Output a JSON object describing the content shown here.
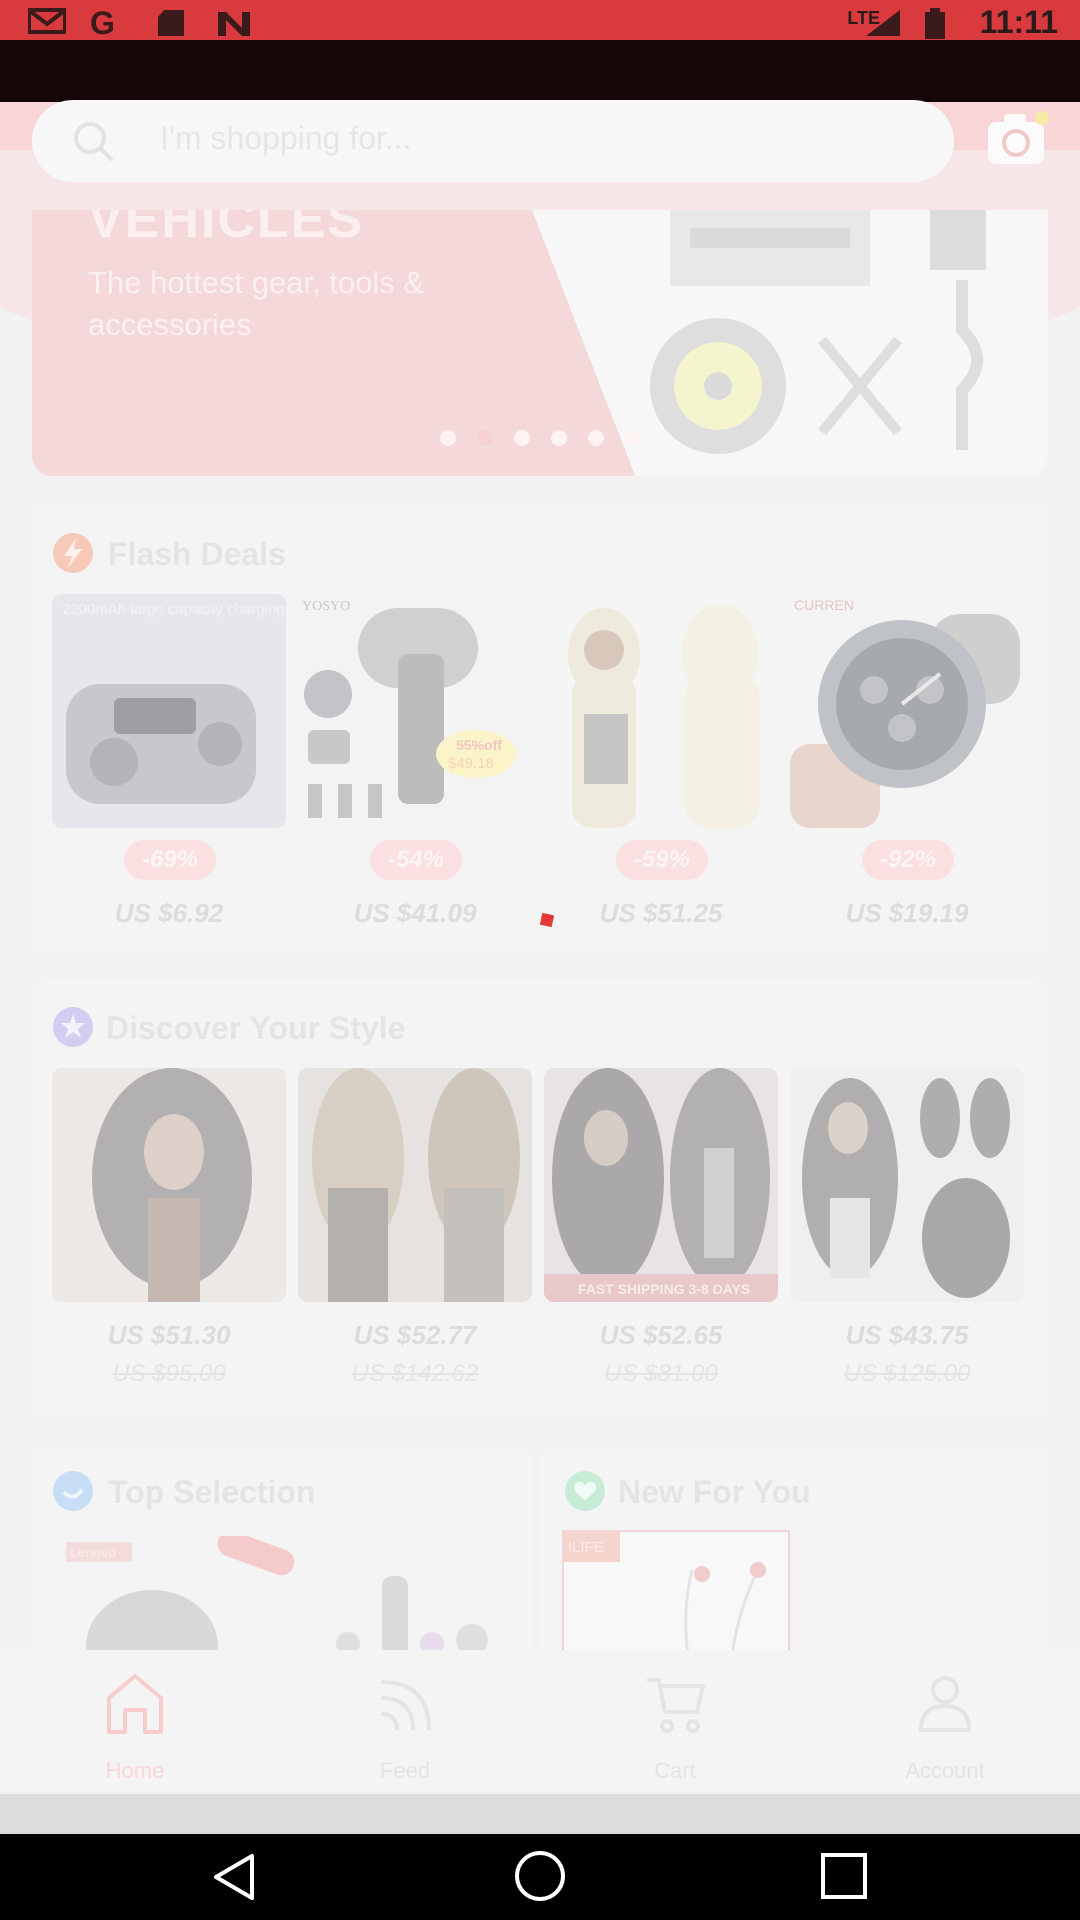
{
  "status_bar": {
    "time": "11:11",
    "network": "LTE",
    "icons": [
      "gmail-icon",
      "google-icon",
      "sd-card-icon",
      "n-app-icon",
      "signal-icon",
      "battery-icon"
    ]
  },
  "search": {
    "placeholder": "I'm shopping for..."
  },
  "banner": {
    "title": "VEHICLES",
    "subtitle": "The hottest gear, tools & accessories",
    "active_dot_index": 1,
    "dot_count": 6
  },
  "flash_deals": {
    "title": "Flash Deals",
    "items": [
      {
        "discount": "-69%",
        "price": "US $6.92",
        "image_caption": "2200mAh large capacity charging box"
      },
      {
        "discount": "-54%",
        "price": "US $41.09",
        "image_caption": "YOSYO",
        "sticker_top": "55%off",
        "sticker_price": "$49.18"
      },
      {
        "discount": "-59%",
        "price": "US $51.25",
        "image_caption": ""
      },
      {
        "discount": "-92%",
        "price": "US $19.19",
        "image_caption": "CURREN"
      }
    ]
  },
  "discover": {
    "title": "Discover Your Style",
    "items": [
      {
        "price": "US $51.30",
        "old_price": "US $95.00"
      },
      {
        "price": "US $52.77",
        "old_price": "US $142.62"
      },
      {
        "price": "US $52.65",
        "old_price": "US $81.00",
        "ribbon": "FAST SHIPPING 3-8 DAYS"
      },
      {
        "price": "US $43.75",
        "old_price": "US $125.00"
      }
    ]
  },
  "top_selection": {
    "title": "Top Selection",
    "brand": "Lenovo"
  },
  "new_for_you": {
    "title": "New For You",
    "brand": "ILIFE"
  },
  "bottom_nav": {
    "items": [
      {
        "label": "Home",
        "icon": "home-icon",
        "active": true
      },
      {
        "label": "Feed",
        "icon": "feed-icon",
        "active": false
      },
      {
        "label": "Cart",
        "icon": "cart-icon",
        "active": false
      },
      {
        "label": "Account",
        "icon": "account-icon",
        "active": false
      }
    ]
  },
  "colors": {
    "brand_red": "#e53935",
    "status_bar": "#d93a3e",
    "overlay_bg": "#f2f2f2"
  }
}
